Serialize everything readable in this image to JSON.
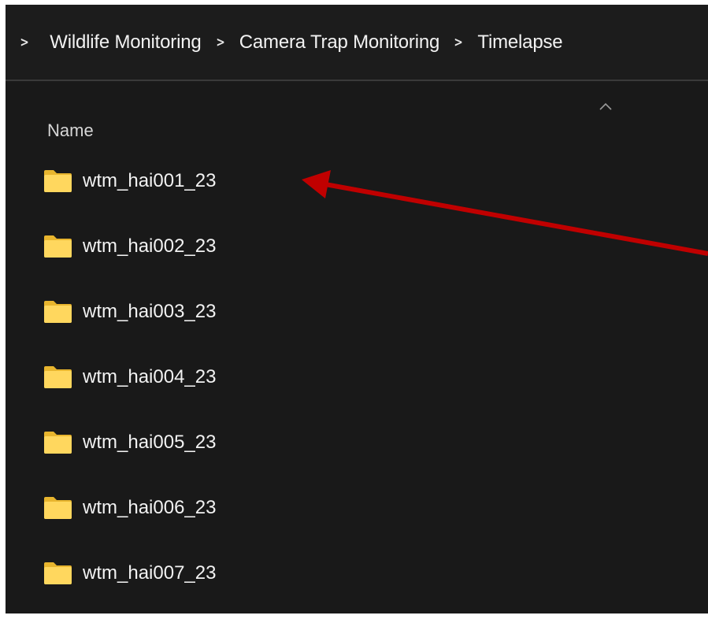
{
  "breadcrumb": [
    {
      "label": "Wildlife Monitoring"
    },
    {
      "label": "Camera Trap Monitoring"
    },
    {
      "label": "Timelapse"
    }
  ],
  "columns": {
    "name": "Name",
    "sort_direction": "ascending"
  },
  "folders": [
    {
      "name": "wtm_hai001_23"
    },
    {
      "name": "wtm_hai002_23"
    },
    {
      "name": "wtm_hai003_23"
    },
    {
      "name": "wtm_hai004_23"
    },
    {
      "name": "wtm_hai005_23"
    },
    {
      "name": "wtm_hai006_23"
    },
    {
      "name": "wtm_hai007_23"
    }
  ],
  "annotation": {
    "type": "arrow",
    "color": "#c00000",
    "points_to": "wtm_hai001_23"
  },
  "colors": {
    "background": "#191919",
    "text": "#f2f2f2",
    "folder": "#ffd75e"
  }
}
